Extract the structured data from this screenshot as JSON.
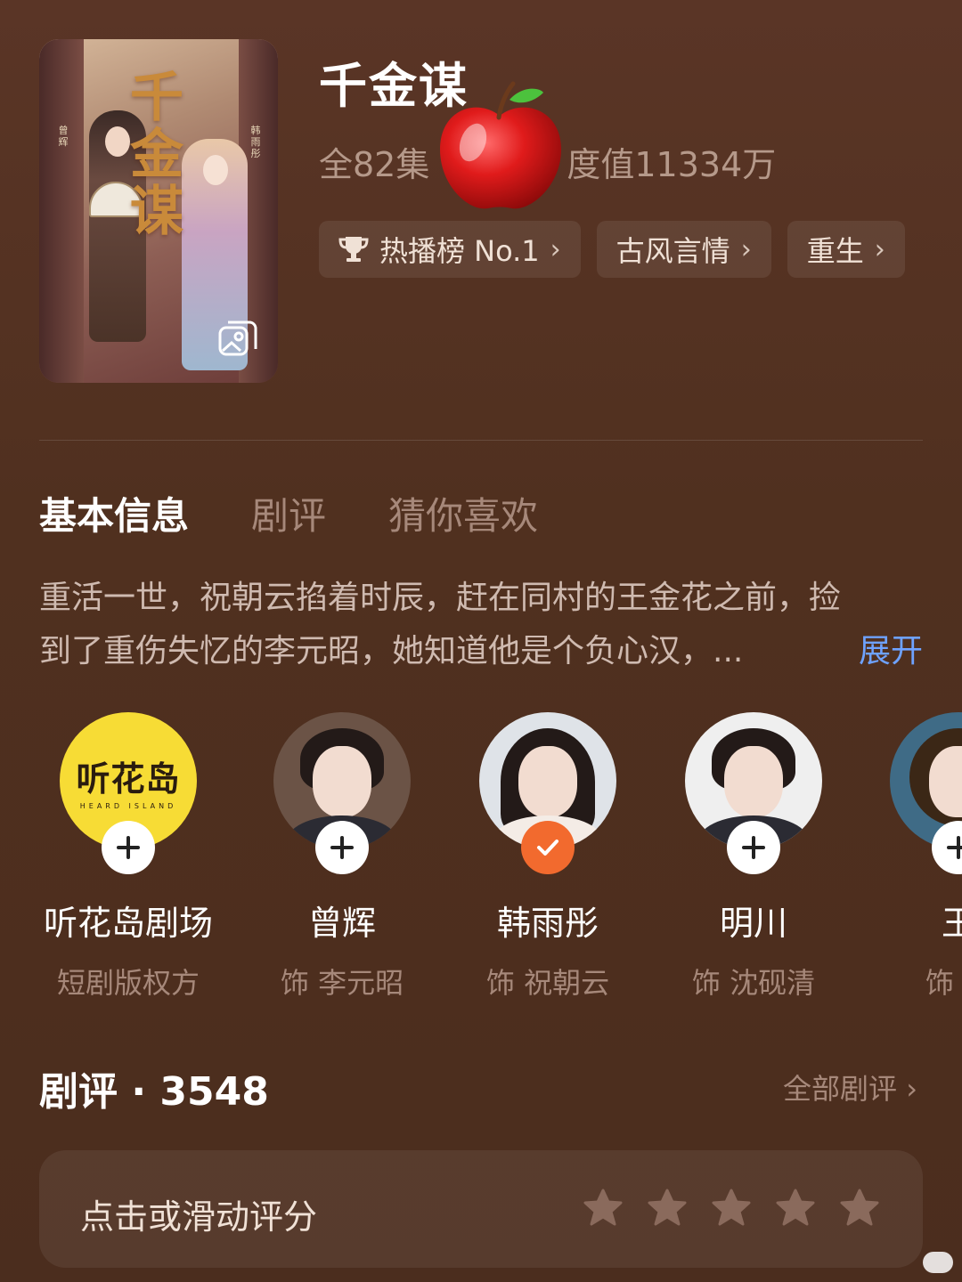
{
  "drama": {
    "title": "千金谋",
    "episodes_text": "全82集",
    "heat_text": "度值11334万",
    "poster": {
      "title_art": "千金谋",
      "side_left": "曾 辉",
      "side_right": "韩雨彤"
    }
  },
  "tags": [
    {
      "label": "热播榜 No.1",
      "icon": "trophy-icon"
    },
    {
      "label": "古风言情"
    },
    {
      "label": "重生"
    }
  ],
  "tabs": [
    "基本信息",
    "剧评",
    "猜你喜欢"
  ],
  "description": {
    "text": "重活一世，祝朝云掐着时辰，赶在同村的王金花之前，捡到了重伤失忆的李元昭，她知道他是个负心汉，...",
    "expand_label": "展开"
  },
  "cast": [
    {
      "name": "听花岛剧场",
      "role": "短剧版权方",
      "avatar": "brand",
      "brand_text": "听花岛",
      "brand_sub": "HEARD ISLAND",
      "followed": false
    },
    {
      "name": "曾辉",
      "role": "饰 李元昭",
      "avatar": "person",
      "followed": false
    },
    {
      "name": "韩雨彤",
      "role": "饰 祝朝云",
      "avatar": "person-female",
      "followed": true
    },
    {
      "name": "明川",
      "role": "饰 沈砚清",
      "avatar": "person",
      "followed": false
    },
    {
      "name": "王",
      "role": "饰 王",
      "avatar": "person",
      "followed": false
    }
  ],
  "reviews": {
    "title": "剧评 · 3548",
    "all_label": "全部剧评 ›",
    "rate_label": "点击或滑动评分",
    "stars": 5,
    "rating": 0
  },
  "colors": {
    "background": "#50301f",
    "accent_link": "#6ea2ff",
    "followed_badge": "#f26a2e",
    "muted_text": "#a6887a"
  }
}
